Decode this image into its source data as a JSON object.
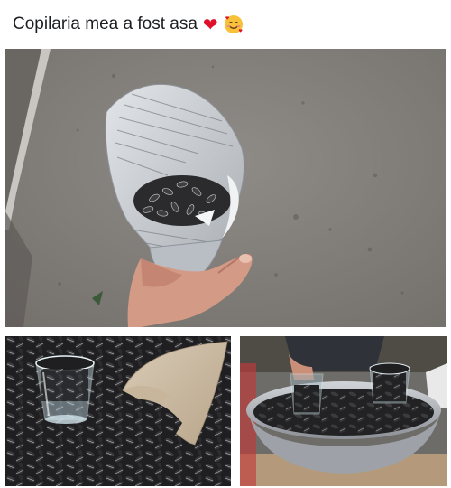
{
  "post": {
    "caption": "Copilaria mea a fost  asa",
    "emojis": {
      "heart": {
        "icon": "red-heart-icon",
        "glyph": "❤"
      },
      "face": {
        "icon": "smiling-face-with-hearts-icon"
      }
    }
  },
  "photos": [
    {
      "name": "paper-cone-sunflower-seeds-photo"
    },
    {
      "name": "glass-and-paper-cone-on-seeds-photo"
    },
    {
      "name": "bowl-of-seeds-with-glasses-photo"
    }
  ],
  "colors": {
    "asphalt": "#8a8682",
    "seed": "#2a2a2c",
    "newspaper": "#c9cdd2",
    "skin": "#d9a08a",
    "metal_bowl": "#a9adb2"
  }
}
